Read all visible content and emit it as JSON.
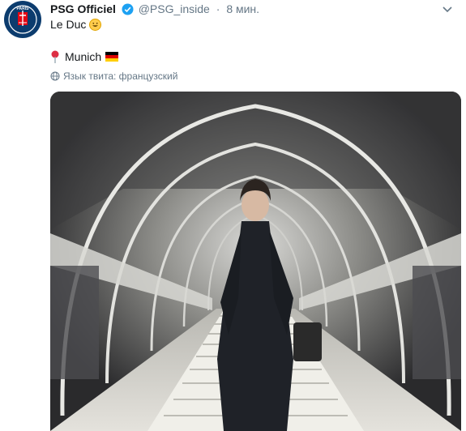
{
  "tweet": {
    "author_name": "PSG Officiel",
    "handle": "@PSG_inside",
    "separator": "·",
    "time": "8 мин.",
    "text_line1": "Le Duc",
    "location": "Munich",
    "translate_label": "Язык твита: французский"
  },
  "avatar": {
    "label": "PARIS",
    "bg": "#0c3c6e",
    "accent": "#e30613"
  },
  "colors": {
    "verified": "#1da1f2",
    "muted": "#657786"
  },
  "icons": [
    "verified-icon",
    "chevron-down-icon",
    "grinning-emoji-icon",
    "round-pushpin-icon",
    "germany-flag-icon",
    "globe-icon"
  ]
}
